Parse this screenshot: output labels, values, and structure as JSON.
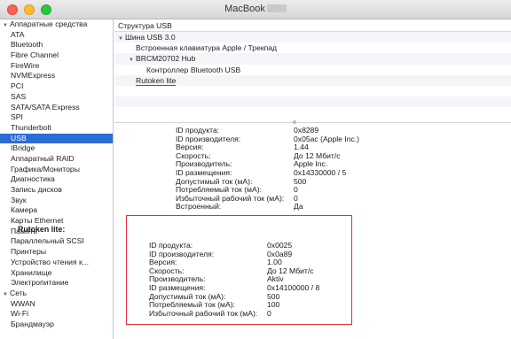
{
  "window": {
    "title": "MacBook"
  },
  "sidebar": {
    "items": [
      {
        "label": "Аппаратные средства",
        "kind": "group"
      },
      {
        "label": "ATA",
        "kind": "sub"
      },
      {
        "label": "Bluetooth",
        "kind": "sub"
      },
      {
        "label": "Fibre Channel",
        "kind": "sub"
      },
      {
        "label": "FireWire",
        "kind": "sub"
      },
      {
        "label": "NVMExpress",
        "kind": "sub"
      },
      {
        "label": "PCI",
        "kind": "sub"
      },
      {
        "label": "SAS",
        "kind": "sub"
      },
      {
        "label": "SATA/SATA Express",
        "kind": "sub"
      },
      {
        "label": "SPI",
        "kind": "sub"
      },
      {
        "label": "Thunderbolt",
        "kind": "sub"
      },
      {
        "label": "USB",
        "kind": "sub",
        "selected": true
      },
      {
        "label": "IBridge",
        "kind": "sub"
      },
      {
        "label": "Аппаратный RAID",
        "kind": "sub"
      },
      {
        "label": "Графика/Мониторы",
        "kind": "sub"
      },
      {
        "label": "Диагностика",
        "kind": "sub"
      },
      {
        "label": "Запись дисков",
        "kind": "sub"
      },
      {
        "label": "Звук",
        "kind": "sub"
      },
      {
        "label": "Камера",
        "kind": "sub"
      },
      {
        "label": "Карты Ethernet",
        "kind": "sub"
      },
      {
        "label": "Память",
        "kind": "sub"
      },
      {
        "label": "Параллельный SCSI",
        "kind": "sub"
      },
      {
        "label": "Принтеры",
        "kind": "sub"
      },
      {
        "label": "Устройство чтения к...",
        "kind": "sub"
      },
      {
        "label": "Хранилище",
        "kind": "sub"
      },
      {
        "label": "Электропитание",
        "kind": "sub"
      },
      {
        "label": "Сеть",
        "kind": "group"
      },
      {
        "label": "WWAN",
        "kind": "sub"
      },
      {
        "label": "Wi-Fi",
        "kind": "sub"
      },
      {
        "label": "Брандмауэр",
        "kind": "sub"
      }
    ]
  },
  "tree": {
    "header": "Структура USB",
    "rows": [
      {
        "label": "Шина USB 3.0",
        "indent": 0,
        "expanded": true
      },
      {
        "label": "Встроенная клавиатура Apple / Трекпад",
        "indent": 1
      },
      {
        "label": "BRCM20702 Hub",
        "indent": 1,
        "expanded": true
      },
      {
        "label": "Контроллер Bluetooth USB",
        "indent": 2
      },
      {
        "label": "Rutoken lite",
        "indent": 1,
        "highlighted": true
      },
      {
        "label": "",
        "indent": 0
      },
      {
        "label": "",
        "indent": 0
      },
      {
        "label": "",
        "indent": 0
      }
    ]
  },
  "detail_top": {
    "rows": [
      {
        "key": "ID продукта:",
        "value": "0x8289"
      },
      {
        "key": "ID производителя:",
        "value": "0x05ac (Apple Inc.)"
      },
      {
        "key": "Версия:",
        "value": "1.44"
      },
      {
        "key": "Скорость:",
        "value": "До 12 Мбит/с"
      },
      {
        "key": "Производитель:",
        "value": "Apple Inc."
      },
      {
        "key": "ID размещения:",
        "value": "0x14330000 / 5"
      },
      {
        "key": "Допустимый ток (мА):",
        "value": "500"
      },
      {
        "key": "Потребляемый ток (мА):",
        "value": "0"
      },
      {
        "key": "Избыточный рабочий ток (мА):",
        "value": "0"
      },
      {
        "key": "Встроенный:",
        "value": "Да"
      }
    ]
  },
  "callout": {
    "title": "Rutoken lite:",
    "rows": [
      {
        "key": "ID продукта:",
        "value": "0x0025"
      },
      {
        "key": "ID производителя:",
        "value": "0x0a89"
      },
      {
        "key": "Версия:",
        "value": "1.00"
      },
      {
        "key": "Скорость:",
        "value": "До 12 Мбит/с"
      },
      {
        "key": "Производитель:",
        "value": "Aktiv"
      },
      {
        "key": "ID размещения:",
        "value": "0x14100000 / 8"
      },
      {
        "key": "Допустимый ток (мА):",
        "value": "500"
      },
      {
        "key": "Потребляемый ток (мА):",
        "value": "100"
      },
      {
        "key": "Избыточный рабочий ток (мА):",
        "value": "0"
      }
    ]
  }
}
